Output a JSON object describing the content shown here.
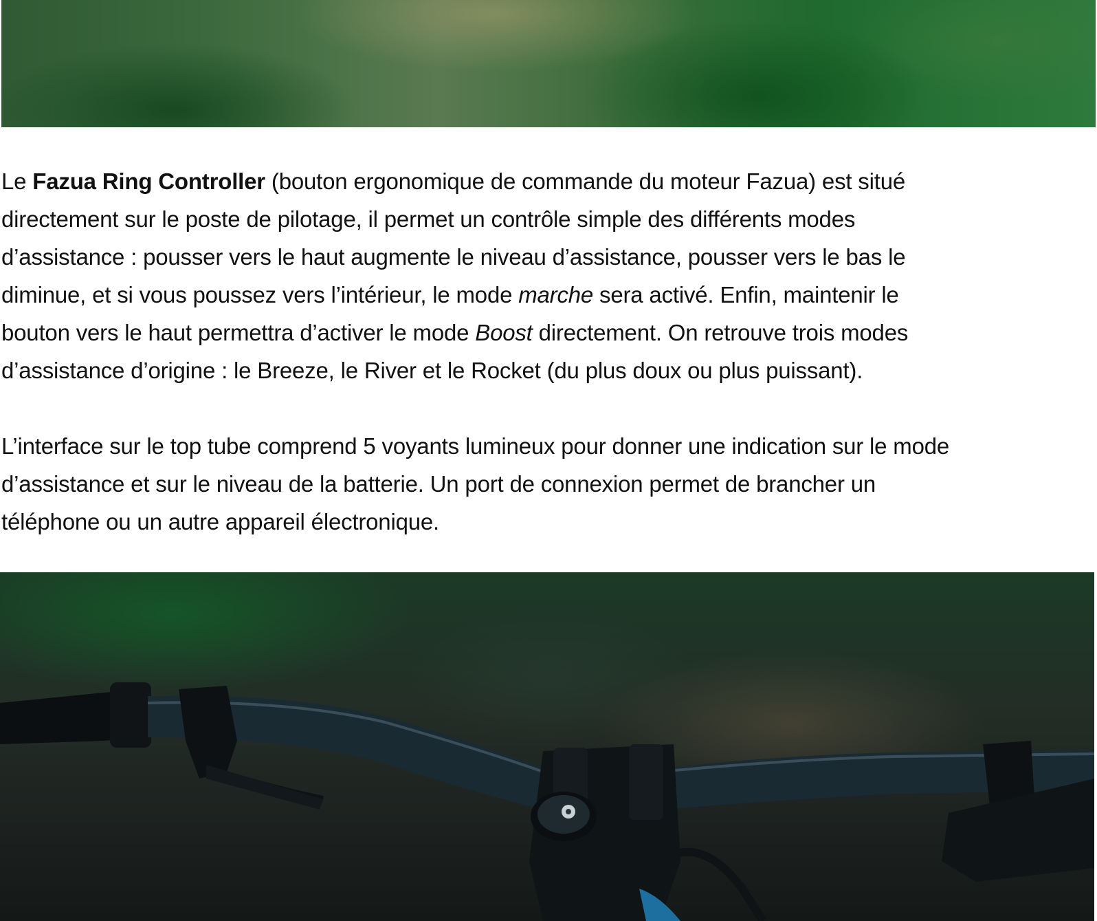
{
  "article": {
    "para1": {
      "l1_a": "Le ",
      "l1_bold": "Fazua Ring Controller",
      "l1_b": " (bouton ergonomique de commande du moteur Fazua) est situé",
      "l2": "directement sur le poste de pilotage, il permet un contrôle simple des différents modes",
      "l3": "d’assistance :  pousser vers le haut augmente le niveau d’assistance, pousser vers le bas le",
      "l4_a": "diminue, et si vous poussez vers l’intérieur, le mode ",
      "l4_italic": "marche",
      "l4_b": " sera activé. Enfin, maintenir le",
      "l5_a": "bouton vers le haut permettra d’activer le mode ",
      "l5_italic": "Boost",
      "l5_b": " directement. On retrouve trois modes",
      "l6": "d’assistance d’origine : le Breeze, le River et le Rocket (du plus doux ou plus puissant)."
    },
    "para2": {
      "l1": "L’interface sur le top tube comprend 5 voyants lumineux pour donner une indication sur le mode",
      "l2": "d’assistance et sur le niveau de la batterie. Un port de connexion permet de brancher un",
      "l3": "téléphone ou un autre appareil électronique."
    }
  },
  "colors": {
    "text": "#111111",
    "background": "#ffffff"
  }
}
